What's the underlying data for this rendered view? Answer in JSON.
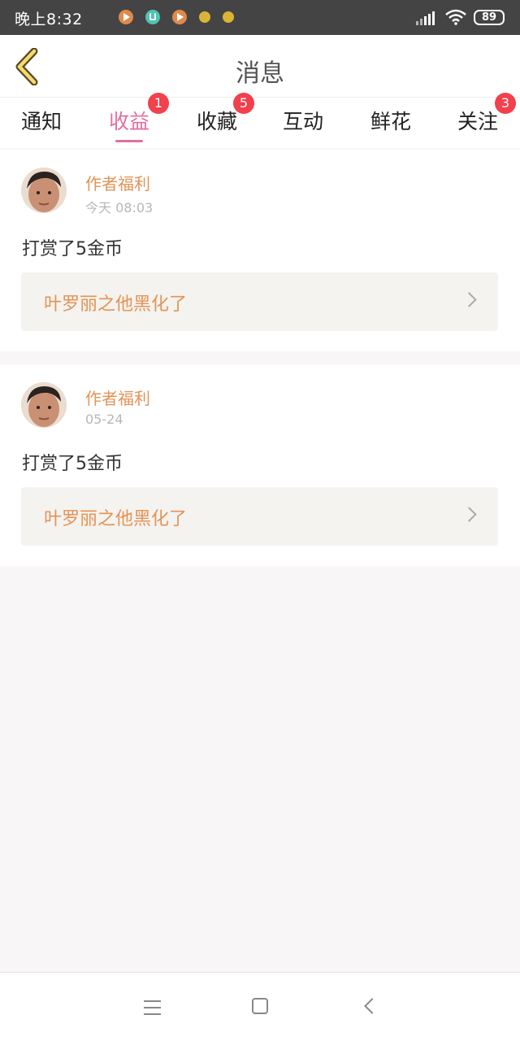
{
  "status_bar": {
    "time": "晚上8:32",
    "battery": "89"
  },
  "header": {
    "title": "消息",
    "back_icon": "chevron-left-icon"
  },
  "tabs": [
    {
      "label": "通知",
      "badge": ""
    },
    {
      "label": "收益",
      "badge": "1",
      "active": true
    },
    {
      "label": "收藏",
      "badge": "5"
    },
    {
      "label": "互动",
      "badge": ""
    },
    {
      "label": "鲜花",
      "badge": ""
    },
    {
      "label": "关注",
      "badge": "3"
    }
  ],
  "messages": [
    {
      "sender": "作者福利",
      "time": "今天 08:03",
      "body": "打赏了5金币",
      "link": "叶罗丽之他黑化了"
    },
    {
      "sender": "作者福利",
      "time": "05-24",
      "body": "打赏了5金币",
      "link": "叶罗丽之他黑化了"
    }
  ],
  "colors": {
    "accent": "#e26f9f",
    "sender": "#e39356",
    "badge": "#f2404c",
    "status_bar": "#444444"
  }
}
